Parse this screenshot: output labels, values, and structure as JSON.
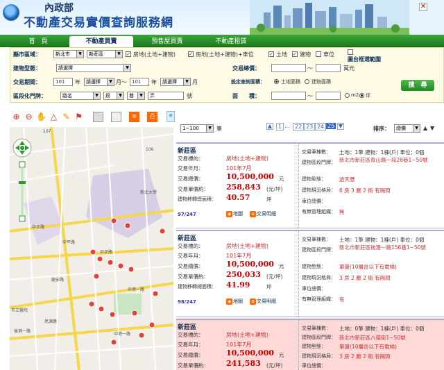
{
  "header": {
    "org": "內政部",
    "site_title": "不動產交易實價查詢服務網",
    "close_glyph": "✕"
  },
  "nav": {
    "tabs": [
      "首　頁",
      "不動產買賣",
      "預售屋買賣",
      "不動產租賃"
    ]
  },
  "search": {
    "row1": {
      "label": "縣市區域：",
      "city": "新北市",
      "district": "新莊區",
      "chk_land_build": "房地(土地+建物)",
      "chk_land_build_unit": "房地(土地+建物)+車位",
      "chk_land": "土地",
      "chk_build": "建物",
      "chk_parking": "車位",
      "map_select": "圖台框選範圍"
    },
    "row2": {
      "label": "建物型態：",
      "type": "請選擇",
      "total_label": "交易總價：",
      "unit": "萬元",
      "sep": "～"
    },
    "row3": {
      "label": "交易期間：",
      "y1": "101",
      "y_lbl": "年",
      "m1": "請選擇",
      "m_lbl": "月～",
      "y2": "101",
      "y2_lbl": "年",
      "m2": "請選擇",
      "m2_lbl": "月",
      "unit_label": "設定查詢面積：",
      "r1": "土地面積",
      "r2": "建物面積"
    },
    "row4": {
      "label": "區段化門牌：",
      "road": "路名",
      "sec": "段",
      "lane": "巷",
      "alley": "弄",
      "no": "號",
      "area_label": "面　　積：",
      "sep": "～",
      "m2": "m2",
      "ping": "坪"
    },
    "search_button": "搜　尋"
  },
  "toolbar": {
    "icons": [
      "zoom-in-icon",
      "zoom-out-icon",
      "pan-icon",
      "measure-icon",
      "marker-icon",
      "layer-icon",
      "layer2-icon",
      "info-icon",
      "print-icon"
    ],
    "collapse": "«"
  },
  "map": {
    "labels": [
      "107",
      "106",
      "新北大學",
      "中正路",
      "中平路",
      "中正路",
      "中港一路",
      "龍安路",
      "思源路",
      "中港一路",
      "市立醫院",
      "後港一路"
    ]
  },
  "pager": {
    "range": "1~100",
    "unit": "筆",
    "pages": [
      "1",
      "...",
      "22",
      "23",
      "24",
      "25"
    ],
    "current": "25",
    "sort_label": "排序：",
    "sort": "總價",
    "asc": "▲",
    "desc": "▼"
  },
  "listings": [
    {
      "district": "新莊區",
      "type_k": "交易標的：",
      "type_v": "房地(土地+建物)",
      "date_k": "交易年月：",
      "date_v": "101年7月",
      "total_k": "交易總價：",
      "total_v": "10,500,000",
      "total_u": "元",
      "unit_k": "交易單價約：",
      "unit_v": "258,843",
      "unit_u": "(元/坪)",
      "area_k": "建物移轉總面積：",
      "area_v": "40.57",
      "area_u": "坪",
      "count": "97/247",
      "map_btn": "地圖",
      "detail_btn": "交易明細",
      "r": [
        {
          "k": "交易筆棟數：",
          "v": "土地：1筆 建物：1棟(戶) 車位：0個",
          "dark": true
        },
        {
          "k": "建物區段門牌：",
          "v": "新北市新莊區青山路一段28巷1~50號"
        },
        {
          "k": "建物型態：",
          "v": "透天厝"
        },
        {
          "k": "建物現況格局：",
          "v": "6 房 3 廳 2 衛 有隔間"
        },
        {
          "k": "車位總價：",
          "v": ""
        },
        {
          "k": "有無管理組織：",
          "v": "無"
        }
      ]
    },
    {
      "district": "新莊區",
      "type_k": "交易標的：",
      "type_v": "房地(土地+建物)",
      "date_k": "交易年月：",
      "date_v": "101年7月",
      "total_k": "交易總價：",
      "total_v": "10,500,000",
      "total_u": "元",
      "unit_k": "交易單價約：",
      "unit_v": "250,033",
      "unit_u": "(元/坪)",
      "area_k": "建物移轉總面積：",
      "area_v": "41.99",
      "area_u": "坪",
      "count": "98/247",
      "map_btn": "地圖",
      "detail_btn": "交易明細",
      "r": [
        {
          "k": "交易筆棟數：",
          "v": "土地：1筆 建物：1棟(戶) 車位：0個",
          "dark": true
        },
        {
          "k": "建物區段門牌：",
          "v": "新北市新莊區後港一路156巷1~50號"
        },
        {
          "k": "建物型態：",
          "v": "華廈(10層含以下有電梯)"
        },
        {
          "k": "建物現況格局：",
          "v": "3 房 2 廳 2 衛 有隔間"
        },
        {
          "k": "車位總價：",
          "v": ""
        },
        {
          "k": "有無管理組織：",
          "v": "有"
        }
      ]
    },
    {
      "district": "新莊區",
      "type_k": "交易標的：",
      "type_v": "房地(土地+建物)",
      "date_k": "交易年月：",
      "date_v": "101年7月",
      "total_k": "交易總價：",
      "total_v": "10,500,000",
      "total_u": "元",
      "unit_k": "交易單價約：",
      "unit_v": "241,583",
      "unit_u": "(元/坪)",
      "r": [
        {
          "k": "交易筆棟數：",
          "v": "土地：0筆 建物：1棟(戶) 車位：0個",
          "dark": true
        },
        {
          "k": "建物區段門牌：",
          "v": "新北市新莊區八德街1~50號"
        },
        {
          "k": "建物型態：",
          "v": "華廈(10層含以下有電梯)"
        },
        {
          "k": "建物現況格局：",
          "v": "3 房 2 廳 2 衛 有隔間"
        },
        {
          "k": "車位總價：",
          "v": ""
        }
      ]
    }
  ],
  "colors": {
    "nav_green": "#2a9a2a",
    "highlight_row": "#ffd8d8",
    "price_red": "#cc0000"
  }
}
